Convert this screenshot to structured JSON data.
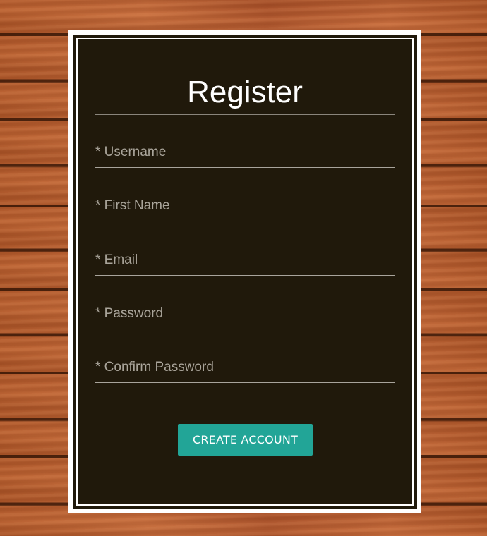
{
  "form": {
    "title": "Register",
    "fields": [
      {
        "placeholder": "* Username",
        "value": ""
      },
      {
        "placeholder": "* First Name",
        "value": ""
      },
      {
        "placeholder": "* Email",
        "value": ""
      },
      {
        "placeholder": "* Password",
        "value": ""
      },
      {
        "placeholder": "* Confirm Password",
        "value": ""
      }
    ],
    "submit_label": "CREATE ACCOUNT"
  },
  "colors": {
    "card_background": "#20190b",
    "card_border": "#ffffff",
    "button_accent": "#22a597",
    "wood_background": "#b45a2c"
  }
}
